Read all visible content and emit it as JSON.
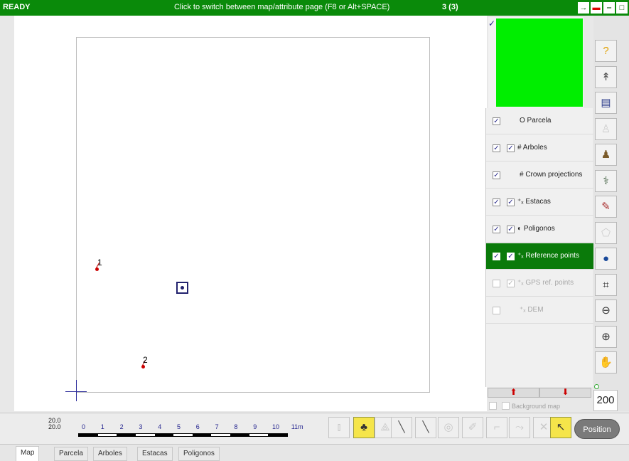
{
  "titlebar": {
    "status": "READY",
    "hint": "Click to switch between map/attribute page (F8 or Alt+SPACE)",
    "count": "3 (3)",
    "window_buttons": [
      "→",
      "▬",
      "‒",
      "□"
    ]
  },
  "map": {
    "tree_labels": [
      "1",
      "2"
    ]
  },
  "overview": {
    "check_mark": "✓"
  },
  "layers": [
    {
      "name": "O Parcela",
      "checked": true,
      "sub_checked": null,
      "state": "normal"
    },
    {
      "name": "# Arboles",
      "checked": true,
      "sub_checked": true,
      "state": "normal"
    },
    {
      "name": "# Crown projections",
      "checked": true,
      "sub_checked": null,
      "state": "normal"
    },
    {
      "name": "⁺ₓ Estacas",
      "checked": true,
      "sub_checked": true,
      "state": "normal"
    },
    {
      "name": "◐ Poligonos",
      "checked": true,
      "sub_checked": true,
      "state": "normal"
    },
    {
      "name": "⁺ₓ Reference points",
      "checked": true,
      "sub_checked": true,
      "state": "selected"
    },
    {
      "name": "⁺ₓ GPS ref. points",
      "checked": false,
      "sub_checked": true,
      "state": "disabled"
    },
    {
      "name": "⁺ₓ DEM",
      "checked": false,
      "sub_checked": null,
      "state": "disabled"
    }
  ],
  "layer_controls": {
    "move_up": "⬆",
    "move_down": "⬇",
    "background_map": "Background map"
  },
  "right_tools": [
    {
      "icon": "help-icon",
      "glyph": "?",
      "color": "#e0a000",
      "enabled": true
    },
    {
      "icon": "north-arrow-icon",
      "glyph": "↟",
      "color": "#555555",
      "enabled": true
    },
    {
      "icon": "table-icon",
      "glyph": "▤",
      "color": "#2a3a8a",
      "enabled": true
    },
    {
      "icon": "walk-icon",
      "glyph": "♙",
      "color": "#cccccc",
      "enabled": false
    },
    {
      "icon": "tree-add-icon",
      "glyph": "♟",
      "color": "#7a5a2a",
      "enabled": true
    },
    {
      "icon": "hook-icon",
      "glyph": "⚕",
      "color": "#3a5a3a",
      "enabled": true
    },
    {
      "icon": "measure-icon",
      "glyph": "✎",
      "color": "#a33",
      "enabled": true
    },
    {
      "icon": "polygon-icon",
      "glyph": "⬠",
      "color": "#cccccc",
      "enabled": false
    },
    {
      "icon": "globe-icon",
      "glyph": "●",
      "color": "#1a4a9a",
      "enabled": true
    },
    {
      "icon": "extent-icon",
      "glyph": "⌗",
      "color": "#333333",
      "enabled": true
    },
    {
      "icon": "zoom-out-icon",
      "glyph": "⊖",
      "color": "#333333",
      "enabled": true
    },
    {
      "icon": "zoom-in-icon",
      "glyph": "⊕",
      "color": "#333333",
      "enabled": true
    },
    {
      "icon": "pan-hand-icon",
      "glyph": "✋",
      "color": "#333333",
      "enabled": true
    }
  ],
  "zoom_level": "200",
  "scale": {
    "top_text": "20.0",
    "bottom_text": "20.0",
    "ticks": [
      "0",
      "1",
      "2",
      "3",
      "4",
      "5",
      "6",
      "7",
      "8",
      "9",
      "10",
      "11m"
    ]
  },
  "bottom_tools": [
    {
      "icon": "thermometer-icon",
      "glyph": "⫾",
      "state": "disabled"
    },
    {
      "icon": "tree-select-icon",
      "glyph": "♣",
      "state": "active"
    },
    {
      "icon": "polygon-tool-icon",
      "glyph": "⟁",
      "state": "disabled"
    },
    {
      "icon": "tape-icon",
      "glyph": "╲",
      "state": "normal"
    },
    {
      "icon": "line-tool-icon",
      "glyph": "╲",
      "state": "normal"
    },
    {
      "icon": "circle-tool-icon",
      "glyph": "◎",
      "state": "disabled"
    },
    {
      "icon": "edit-icon",
      "glyph": "✐",
      "state": "disabled"
    },
    {
      "icon": "branch-icon",
      "glyph": "⌐",
      "state": "disabled"
    },
    {
      "icon": "split-icon",
      "glyph": "⤳",
      "state": "disabled"
    },
    {
      "icon": "delete-icon",
      "glyph": "✕",
      "state": "disabled"
    },
    {
      "icon": "select-arrow-icon",
      "glyph": "↖",
      "state": "active"
    }
  ],
  "position_button": "Position",
  "tabs": [
    {
      "label": "Map",
      "active": true
    },
    {
      "label": "Parcela",
      "active": false
    },
    {
      "label": "Arboles",
      "active": false
    },
    {
      "label": "Estacas",
      "active": false
    },
    {
      "label": "Poligonos",
      "active": false
    }
  ]
}
